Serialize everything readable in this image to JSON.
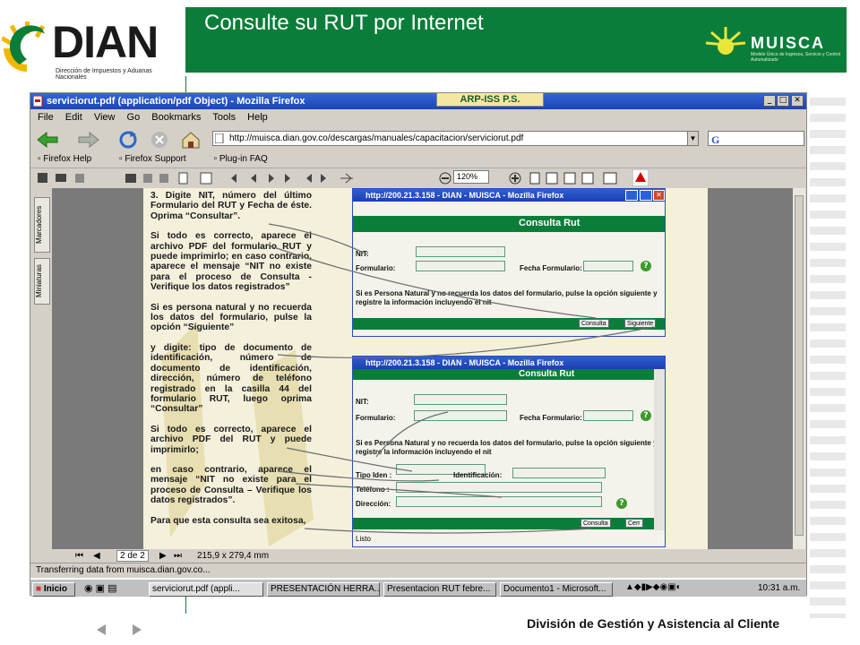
{
  "header": {
    "logo_text": "DIAN",
    "logo_sub": "Dirección de Impuestos y Aduanas Nacionales",
    "title": "Consulte su RUT por Internet",
    "muisca_text": "MUISCA",
    "muisca_sub": "Modelo Único de Ingresos, Servicio y Control Automatizado"
  },
  "footer": {
    "text": "División de Gestión y Asistencia al Cliente"
  },
  "overlay": {
    "arp_iss": "ARP-ISS P.S."
  },
  "browser": {
    "title": "serviciorut.pdf (application/pdf Object) - Mozilla Firefox",
    "menu": [
      "File",
      "Edit",
      "View",
      "Go",
      "Bookmarks",
      "Tools",
      "Help"
    ],
    "url": "http://muisca.dian.gov.co/descargas/manuales/capacitacion/serviciorut.pdf",
    "bookmarks": [
      "Firefox Help",
      "Firefox Support",
      "Plug-in FAQ"
    ],
    "zoom": "120%",
    "page_num": "2 de 2",
    "page_size": "215,9 x 279,4 mm",
    "status": "Transferring data from muisca.dian.gov.co...",
    "side_tabs": [
      "Marcadores",
      "Miniaturas"
    ]
  },
  "pdf_text": [
    "3. Digite NIT, número del último Formulario del RUT y Fecha de éste. Oprima “Consultar”.",
    "Si todo es correcto, aparece el archivo PDF del formulario RUT y puede imprimirlo; en caso contrario, aparece el mensaje “NIT no existe para el proceso de Consulta - Verifique los datos registrados”",
    "Si es persona natural y no recuerda los datos del formulario, pulse la opción “Siguiente”",
    "y digite: tipo de documento de identificación, número de documento de identificación, dirección, número de teléfono registrado en la casilla 44 del formulario RUT, luego oprima “Consultar”",
    "Si todo es correcto, aparece el archivo PDF del RUT y puede imprimirlo;",
    "en caso contrario, aparece el mensaje “NIT no existe para el proceso de Consulta – Verifique los datos registrados”.",
    "Para que esta consulta sea exitosa,"
  ],
  "inner1": {
    "title": "http://200.21.3.158 - DIAN - MUISCA - Mozilla Firefox",
    "heading": "Consulta Rut",
    "nit": "NIT:",
    "formulario": "Formulario:",
    "fecha": "Fecha Formulario:",
    "note": "Si es Persona Natural y no recuerda los datos del formulario, pulse la opción siguiente y registre la información incluyendo el nit",
    "consulta": "Consulta",
    "siguiente": "Siguiente"
  },
  "inner2": {
    "title": "http://200.21.3.158 - DIAN - MUISCA - Mozilla Firefox",
    "heading": "Consulta Rut",
    "nit": "NIT:",
    "formulario": "Formulario:",
    "fecha": "Fecha Formulario:",
    "note": "Si es Persona Natural y no recuerda los datos del formulario, pulse la opción siguiente y registre la información incluyendo el nit",
    "tipo": "Tipo Iden :",
    "identificacion": "Identificación:",
    "telefono": "Teléfono :",
    "direccion": "Dirección:",
    "consulta": "Consulta",
    "cerrar": "Cerr",
    "status": "Listo"
  },
  "taskbar": {
    "start": "Inicio",
    "tasks": [
      "serviciorut.pdf (appli...",
      "PRESENTACIÓN HERRA...",
      "Presentacion RUT febre...",
      "Documento1 - Microsoft..."
    ],
    "clock": "10:31 a.m."
  },
  "colors": {
    "dian_green": "#0b7d3a",
    "xp_blue": "#2e5fd3"
  }
}
